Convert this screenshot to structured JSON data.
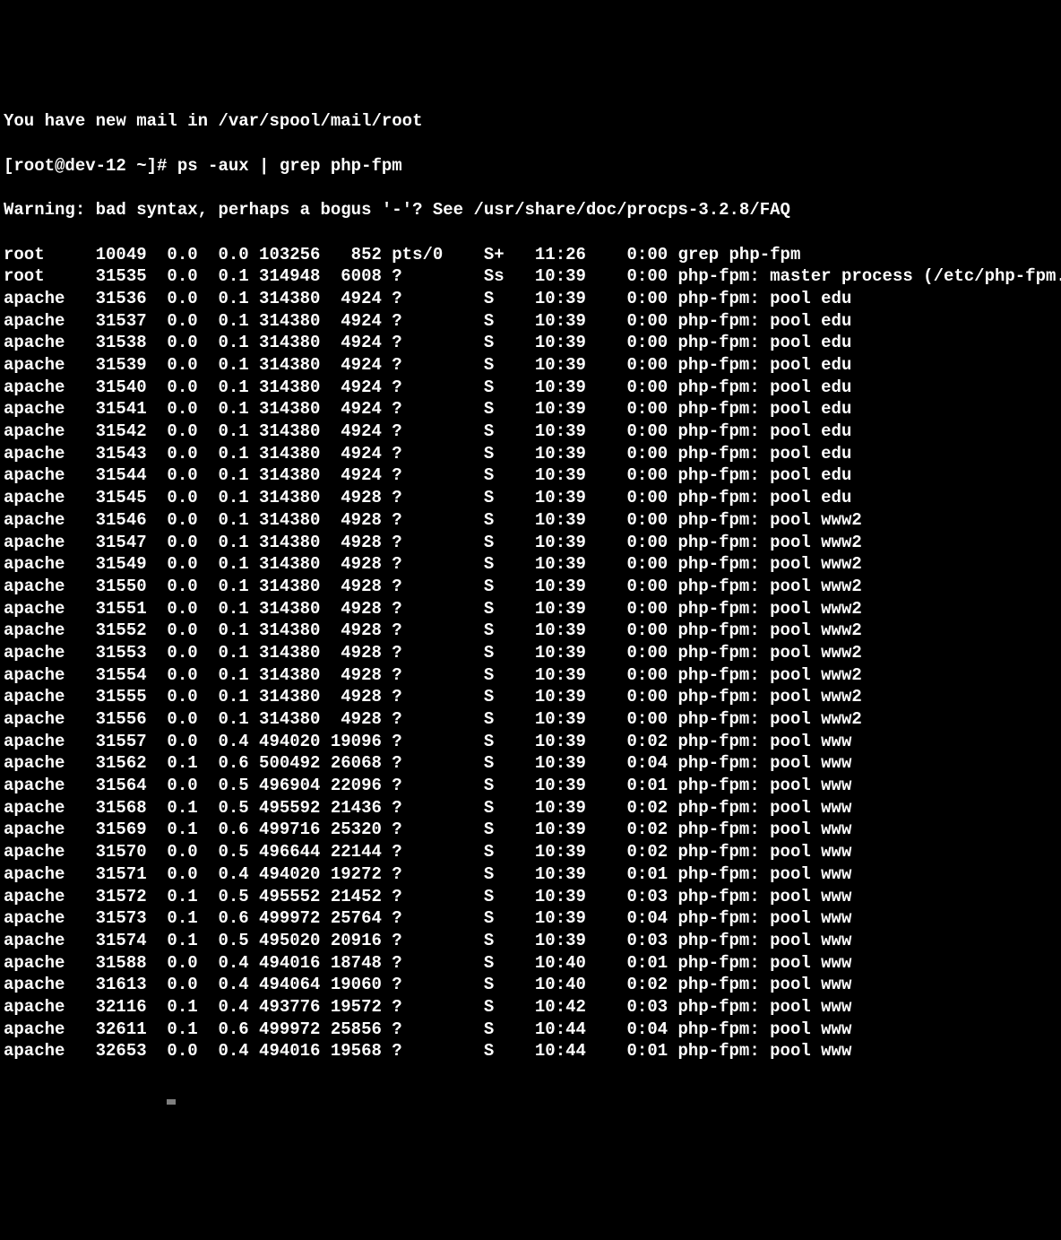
{
  "topline": "You have new mail in /var/spool/mail/root",
  "prompt": "[root@dev-12 ~]# ",
  "command": "ps -aux | grep php-fpm",
  "warning": "Warning: bad syntax, perhaps a bogus '-'? See /usr/share/doc/procps-3.2.8/FAQ",
  "rows": [
    {
      "user": "root",
      "pid": "10049",
      "cpu": "0.0",
      "mem": "0.0",
      "vsz": "103256",
      "rss": "852",
      "tty": "pts/0",
      "stat": "S+",
      "start": "11:26",
      "time": "0:00",
      "cmd": "grep php-fpm"
    },
    {
      "user": "root",
      "pid": "31535",
      "cpu": "0.0",
      "mem": "0.1",
      "vsz": "314948",
      "rss": "6008",
      "tty": "?",
      "stat": "Ss",
      "start": "10:39",
      "time": "0:00",
      "cmd": "php-fpm: master process (/etc/php-fpm.conf)"
    },
    {
      "user": "apache",
      "pid": "31536",
      "cpu": "0.0",
      "mem": "0.1",
      "vsz": "314380",
      "rss": "4924",
      "tty": "?",
      "stat": "S",
      "start": "10:39",
      "time": "0:00",
      "cmd": "php-fpm: pool edu"
    },
    {
      "user": "apache",
      "pid": "31537",
      "cpu": "0.0",
      "mem": "0.1",
      "vsz": "314380",
      "rss": "4924",
      "tty": "?",
      "stat": "S",
      "start": "10:39",
      "time": "0:00",
      "cmd": "php-fpm: pool edu"
    },
    {
      "user": "apache",
      "pid": "31538",
      "cpu": "0.0",
      "mem": "0.1",
      "vsz": "314380",
      "rss": "4924",
      "tty": "?",
      "stat": "S",
      "start": "10:39",
      "time": "0:00",
      "cmd": "php-fpm: pool edu"
    },
    {
      "user": "apache",
      "pid": "31539",
      "cpu": "0.0",
      "mem": "0.1",
      "vsz": "314380",
      "rss": "4924",
      "tty": "?",
      "stat": "S",
      "start": "10:39",
      "time": "0:00",
      "cmd": "php-fpm: pool edu"
    },
    {
      "user": "apache",
      "pid": "31540",
      "cpu": "0.0",
      "mem": "0.1",
      "vsz": "314380",
      "rss": "4924",
      "tty": "?",
      "stat": "S",
      "start": "10:39",
      "time": "0:00",
      "cmd": "php-fpm: pool edu"
    },
    {
      "user": "apache",
      "pid": "31541",
      "cpu": "0.0",
      "mem": "0.1",
      "vsz": "314380",
      "rss": "4924",
      "tty": "?",
      "stat": "S",
      "start": "10:39",
      "time": "0:00",
      "cmd": "php-fpm: pool edu"
    },
    {
      "user": "apache",
      "pid": "31542",
      "cpu": "0.0",
      "mem": "0.1",
      "vsz": "314380",
      "rss": "4924",
      "tty": "?",
      "stat": "S",
      "start": "10:39",
      "time": "0:00",
      "cmd": "php-fpm: pool edu"
    },
    {
      "user": "apache",
      "pid": "31543",
      "cpu": "0.0",
      "mem": "0.1",
      "vsz": "314380",
      "rss": "4924",
      "tty": "?",
      "stat": "S",
      "start": "10:39",
      "time": "0:00",
      "cmd": "php-fpm: pool edu"
    },
    {
      "user": "apache",
      "pid": "31544",
      "cpu": "0.0",
      "mem": "0.1",
      "vsz": "314380",
      "rss": "4924",
      "tty": "?",
      "stat": "S",
      "start": "10:39",
      "time": "0:00",
      "cmd": "php-fpm: pool edu"
    },
    {
      "user": "apache",
      "pid": "31545",
      "cpu": "0.0",
      "mem": "0.1",
      "vsz": "314380",
      "rss": "4928",
      "tty": "?",
      "stat": "S",
      "start": "10:39",
      "time": "0:00",
      "cmd": "php-fpm: pool edu"
    },
    {
      "user": "apache",
      "pid": "31546",
      "cpu": "0.0",
      "mem": "0.1",
      "vsz": "314380",
      "rss": "4928",
      "tty": "?",
      "stat": "S",
      "start": "10:39",
      "time": "0:00",
      "cmd": "php-fpm: pool www2"
    },
    {
      "user": "apache",
      "pid": "31547",
      "cpu": "0.0",
      "mem": "0.1",
      "vsz": "314380",
      "rss": "4928",
      "tty": "?",
      "stat": "S",
      "start": "10:39",
      "time": "0:00",
      "cmd": "php-fpm: pool www2"
    },
    {
      "user": "apache",
      "pid": "31549",
      "cpu": "0.0",
      "mem": "0.1",
      "vsz": "314380",
      "rss": "4928",
      "tty": "?",
      "stat": "S",
      "start": "10:39",
      "time": "0:00",
      "cmd": "php-fpm: pool www2"
    },
    {
      "user": "apache",
      "pid": "31550",
      "cpu": "0.0",
      "mem": "0.1",
      "vsz": "314380",
      "rss": "4928",
      "tty": "?",
      "stat": "S",
      "start": "10:39",
      "time": "0:00",
      "cmd": "php-fpm: pool www2"
    },
    {
      "user": "apache",
      "pid": "31551",
      "cpu": "0.0",
      "mem": "0.1",
      "vsz": "314380",
      "rss": "4928",
      "tty": "?",
      "stat": "S",
      "start": "10:39",
      "time": "0:00",
      "cmd": "php-fpm: pool www2"
    },
    {
      "user": "apache",
      "pid": "31552",
      "cpu": "0.0",
      "mem": "0.1",
      "vsz": "314380",
      "rss": "4928",
      "tty": "?",
      "stat": "S",
      "start": "10:39",
      "time": "0:00",
      "cmd": "php-fpm: pool www2"
    },
    {
      "user": "apache",
      "pid": "31553",
      "cpu": "0.0",
      "mem": "0.1",
      "vsz": "314380",
      "rss": "4928",
      "tty": "?",
      "stat": "S",
      "start": "10:39",
      "time": "0:00",
      "cmd": "php-fpm: pool www2"
    },
    {
      "user": "apache",
      "pid": "31554",
      "cpu": "0.0",
      "mem": "0.1",
      "vsz": "314380",
      "rss": "4928",
      "tty": "?",
      "stat": "S",
      "start": "10:39",
      "time": "0:00",
      "cmd": "php-fpm: pool www2"
    },
    {
      "user": "apache",
      "pid": "31555",
      "cpu": "0.0",
      "mem": "0.1",
      "vsz": "314380",
      "rss": "4928",
      "tty": "?",
      "stat": "S",
      "start": "10:39",
      "time": "0:00",
      "cmd": "php-fpm: pool www2"
    },
    {
      "user": "apache",
      "pid": "31556",
      "cpu": "0.0",
      "mem": "0.1",
      "vsz": "314380",
      "rss": "4928",
      "tty": "?",
      "stat": "S",
      "start": "10:39",
      "time": "0:00",
      "cmd": "php-fpm: pool www2"
    },
    {
      "user": "apache",
      "pid": "31557",
      "cpu": "0.0",
      "mem": "0.4",
      "vsz": "494020",
      "rss": "19096",
      "tty": "?",
      "stat": "S",
      "start": "10:39",
      "time": "0:02",
      "cmd": "php-fpm: pool www"
    },
    {
      "user": "apache",
      "pid": "31562",
      "cpu": "0.1",
      "mem": "0.6",
      "vsz": "500492",
      "rss": "26068",
      "tty": "?",
      "stat": "S",
      "start": "10:39",
      "time": "0:04",
      "cmd": "php-fpm: pool www"
    },
    {
      "user": "apache",
      "pid": "31564",
      "cpu": "0.0",
      "mem": "0.5",
      "vsz": "496904",
      "rss": "22096",
      "tty": "?",
      "stat": "S",
      "start": "10:39",
      "time": "0:01",
      "cmd": "php-fpm: pool www"
    },
    {
      "user": "apache",
      "pid": "31568",
      "cpu": "0.1",
      "mem": "0.5",
      "vsz": "495592",
      "rss": "21436",
      "tty": "?",
      "stat": "S",
      "start": "10:39",
      "time": "0:02",
      "cmd": "php-fpm: pool www"
    },
    {
      "user": "apache",
      "pid": "31569",
      "cpu": "0.1",
      "mem": "0.6",
      "vsz": "499716",
      "rss": "25320",
      "tty": "?",
      "stat": "S",
      "start": "10:39",
      "time": "0:02",
      "cmd": "php-fpm: pool www"
    },
    {
      "user": "apache",
      "pid": "31570",
      "cpu": "0.0",
      "mem": "0.5",
      "vsz": "496644",
      "rss": "22144",
      "tty": "?",
      "stat": "S",
      "start": "10:39",
      "time": "0:02",
      "cmd": "php-fpm: pool www"
    },
    {
      "user": "apache",
      "pid": "31571",
      "cpu": "0.0",
      "mem": "0.4",
      "vsz": "494020",
      "rss": "19272",
      "tty": "?",
      "stat": "S",
      "start": "10:39",
      "time": "0:01",
      "cmd": "php-fpm: pool www"
    },
    {
      "user": "apache",
      "pid": "31572",
      "cpu": "0.1",
      "mem": "0.5",
      "vsz": "495552",
      "rss": "21452",
      "tty": "?",
      "stat": "S",
      "start": "10:39",
      "time": "0:03",
      "cmd": "php-fpm: pool www"
    },
    {
      "user": "apache",
      "pid": "31573",
      "cpu": "0.1",
      "mem": "0.6",
      "vsz": "499972",
      "rss": "25764",
      "tty": "?",
      "stat": "S",
      "start": "10:39",
      "time": "0:04",
      "cmd": "php-fpm: pool www"
    },
    {
      "user": "apache",
      "pid": "31574",
      "cpu": "0.1",
      "mem": "0.5",
      "vsz": "495020",
      "rss": "20916",
      "tty": "?",
      "stat": "S",
      "start": "10:39",
      "time": "0:03",
      "cmd": "php-fpm: pool www"
    },
    {
      "user": "apache",
      "pid": "31588",
      "cpu": "0.0",
      "mem": "0.4",
      "vsz": "494016",
      "rss": "18748",
      "tty": "?",
      "stat": "S",
      "start": "10:40",
      "time": "0:01",
      "cmd": "php-fpm: pool www"
    },
    {
      "user": "apache",
      "pid": "31613",
      "cpu": "0.0",
      "mem": "0.4",
      "vsz": "494064",
      "rss": "19060",
      "tty": "?",
      "stat": "S",
      "start": "10:40",
      "time": "0:02",
      "cmd": "php-fpm: pool www"
    },
    {
      "user": "apache",
      "pid": "32116",
      "cpu": "0.1",
      "mem": "0.4",
      "vsz": "493776",
      "rss": "19572",
      "tty": "?",
      "stat": "S",
      "start": "10:42",
      "time": "0:03",
      "cmd": "php-fpm: pool www"
    },
    {
      "user": "apache",
      "pid": "32611",
      "cpu": "0.1",
      "mem": "0.6",
      "vsz": "499972",
      "rss": "25856",
      "tty": "?",
      "stat": "S",
      "start": "10:44",
      "time": "0:04",
      "cmd": "php-fpm: pool www"
    },
    {
      "user": "apache",
      "pid": "32653",
      "cpu": "0.0",
      "mem": "0.4",
      "vsz": "494016",
      "rss": "19568",
      "tty": "?",
      "stat": "S",
      "start": "10:44",
      "time": "0:01",
      "cmd": "php-fpm: pool www"
    }
  ]
}
